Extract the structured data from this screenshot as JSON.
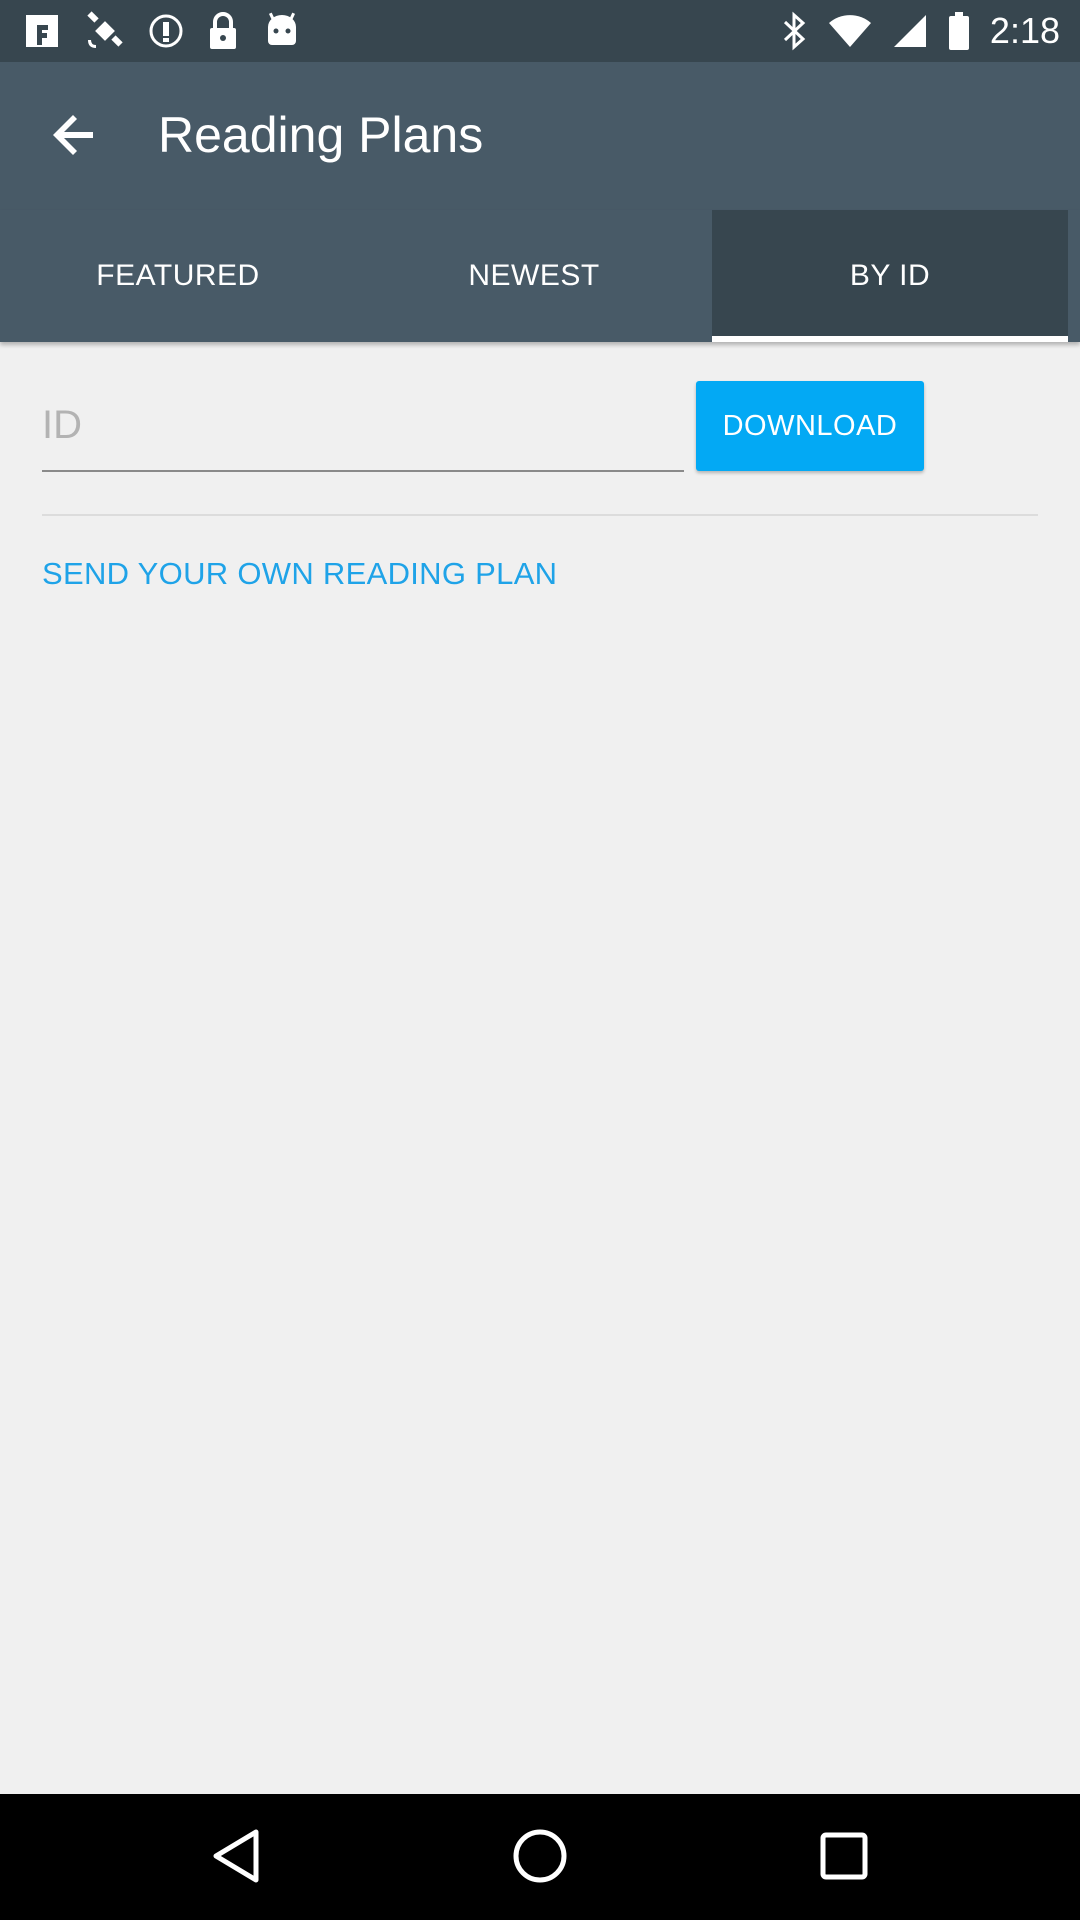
{
  "status_bar": {
    "time": "2:18",
    "left_icons": [
      "fake-gps-icon",
      "satellite-icon",
      "info-circle-icon",
      "lock-icon",
      "android-icon"
    ],
    "right_icons": [
      "bluetooth-icon",
      "wifi-icon",
      "cell-signal-icon",
      "battery-icon"
    ]
  },
  "app_bar": {
    "title": "Reading Plans",
    "back_icon": "arrow-back-icon"
  },
  "tabs": [
    {
      "label": "FEATURED",
      "active": false
    },
    {
      "label": "NEWEST",
      "active": false
    },
    {
      "label": "BY ID",
      "active": true
    }
  ],
  "by_id": {
    "id_placeholder": "ID",
    "id_value": "",
    "download_label": "DOWNLOAD",
    "send_plan_label": "SEND YOUR OWN READING PLAN"
  },
  "nav_bar": {
    "icons": [
      "back-triangle-icon",
      "home-circle-icon",
      "recents-square-icon"
    ]
  },
  "colors": {
    "status_bar": "#37464f",
    "app_bar": "#485a67",
    "accent": "#03a9f4",
    "link": "#1fa3e8",
    "background": "#f0f0f0"
  }
}
